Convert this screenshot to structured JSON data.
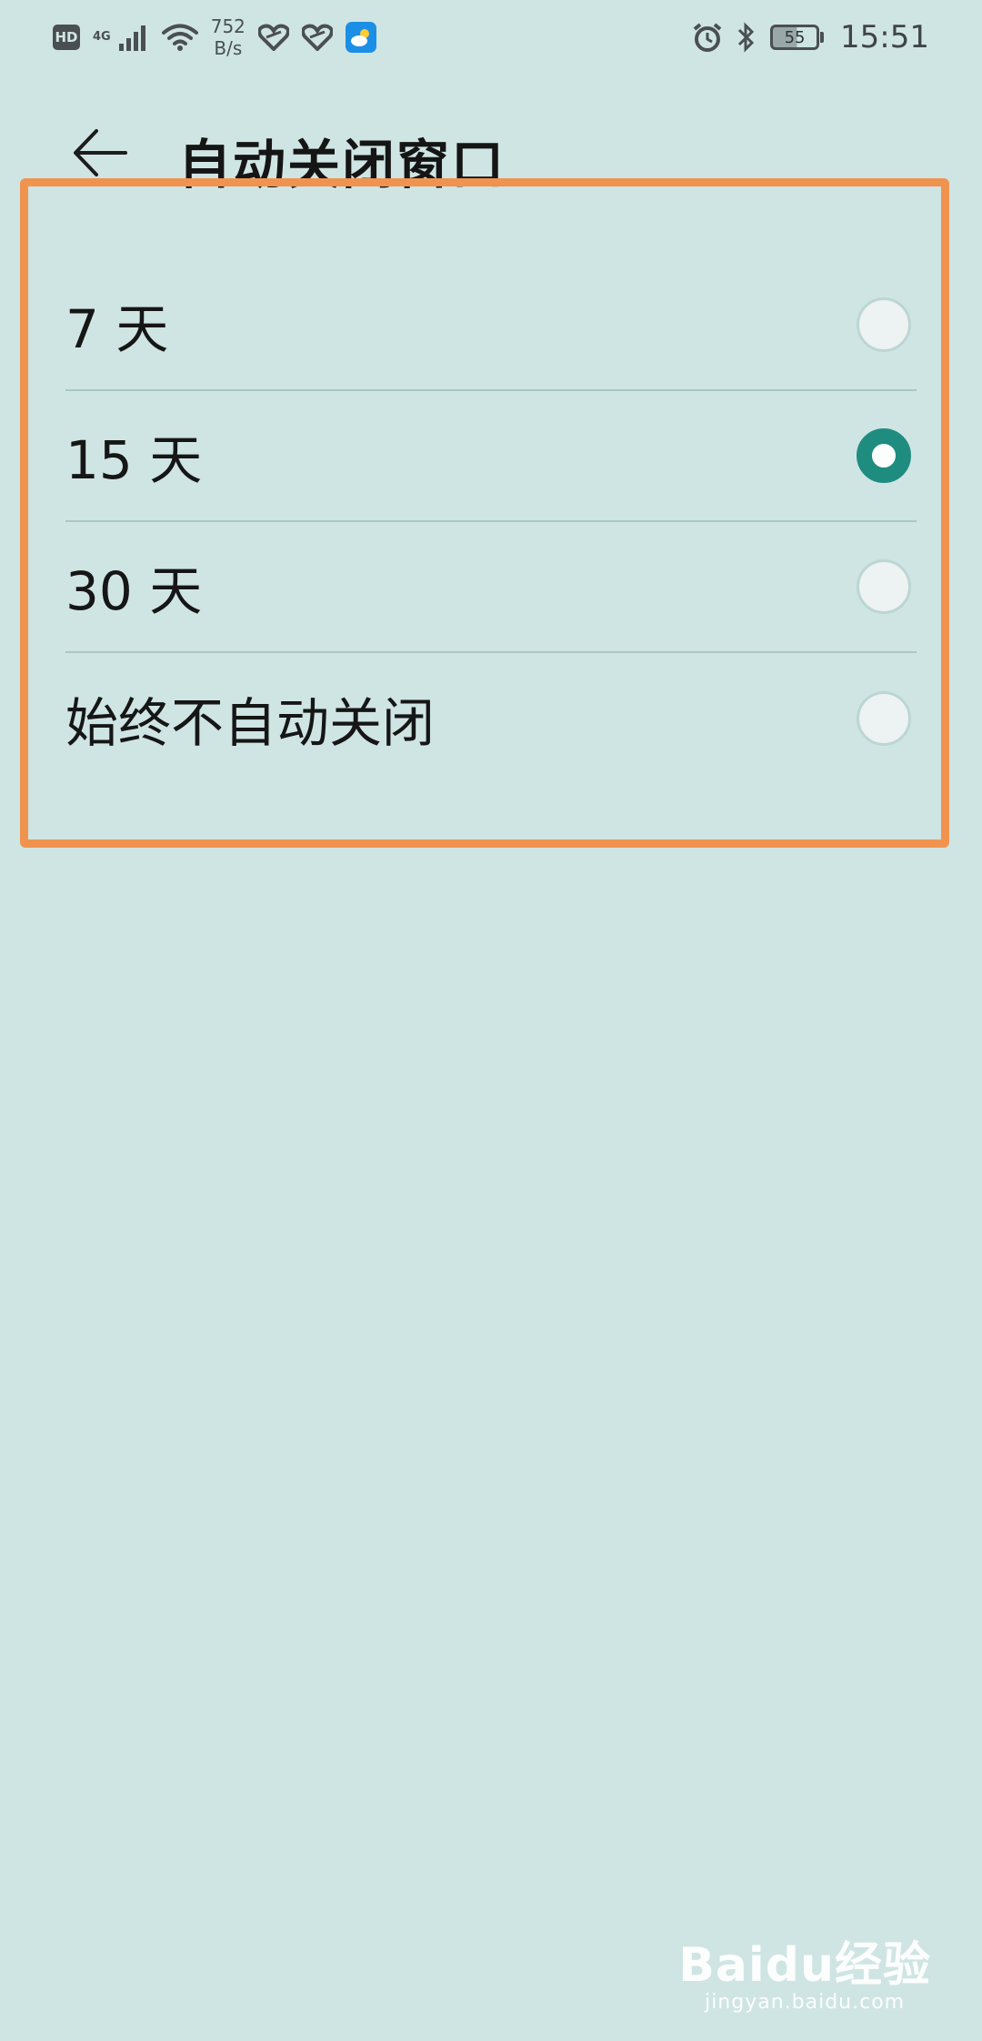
{
  "status_bar": {
    "hd_label": "HD",
    "network_gen": "4G",
    "speed_value": "752",
    "speed_unit": "B/s",
    "battery_level": "55",
    "time": "15:51"
  },
  "header": {
    "title": "自动关闭窗口",
    "back_icon": "arrow-left-icon"
  },
  "options": [
    {
      "label": "7 天",
      "selected": false
    },
    {
      "label": "15 天",
      "selected": true
    },
    {
      "label": "30 天",
      "selected": false
    },
    {
      "label": "始终不自动关闭",
      "selected": false
    }
  ],
  "watermark": {
    "logo": "Baidu经验",
    "url": "jingyan.baidu.com"
  },
  "colors": {
    "background": "#cfe5e3",
    "accent": "#1f8c80",
    "highlight": "#f0934f"
  }
}
